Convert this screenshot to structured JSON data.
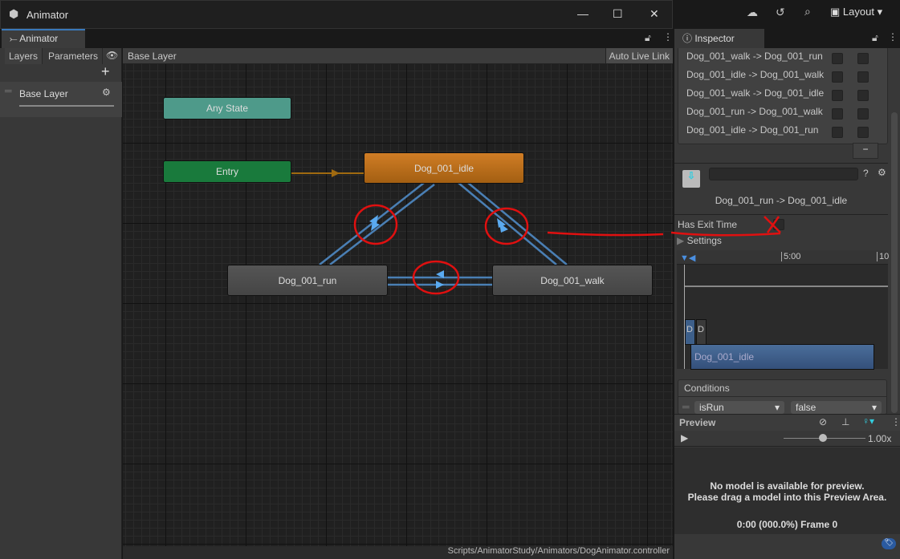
{
  "window": {
    "title": "Animator"
  },
  "topbar": {
    "layout_label": "Layout"
  },
  "animator": {
    "tab_label": "Animator",
    "left_tabs": [
      "Layers",
      "Parameters"
    ],
    "layers": [
      {
        "name": "Base Layer"
      }
    ],
    "breadcrumb": "Base Layer",
    "auto_live_link": "Auto Live Link",
    "states": {
      "any": "Any State",
      "entry": "Entry",
      "idle": "Dog_001_idle",
      "run": "Dog_001_run",
      "walk": "Dog_001_walk"
    },
    "colors": {
      "any": "#4e9a8a",
      "entry": "#197a3c",
      "default": "#c8711c",
      "state": "#4d4d4d",
      "transition": "#5a9fe0",
      "annotation": "#e01010"
    },
    "status_path": "Scripts/AnimatorStudy/Animators/DogAnimator.controller"
  },
  "inspector": {
    "tab_label": "Inspector",
    "transitions": [
      "Dog_001_walk -> Dog_001_run",
      "Dog_001_idle -> Dog_001_walk",
      "Dog_001_walk -> Dog_001_idle",
      "Dog_001_run -> Dog_001_walk",
      "Dog_001_idle -> Dog_001_run"
    ],
    "selected_transition": "Dog_001_run -> Dog_001_idle",
    "has_exit_time_label": "Has Exit Time",
    "has_exit_time": false,
    "settings_label": "Settings",
    "timeline": {
      "ticks": [
        "5:00",
        "10"
      ],
      "clip_a": "D",
      "clip_b": "D",
      "target_clip": "Dog_001_idle"
    },
    "conditions_label": "Conditions",
    "condition": {
      "parameter": "isRun",
      "value": "false"
    }
  },
  "preview": {
    "label": "Preview",
    "speed": "1.00x",
    "speed_fraction": 0.37,
    "message_1": "No model is available for preview.",
    "message_2": "Please drag a model into this Preview Area.",
    "frame_info": "0:00 (000.0%) Frame 0"
  }
}
